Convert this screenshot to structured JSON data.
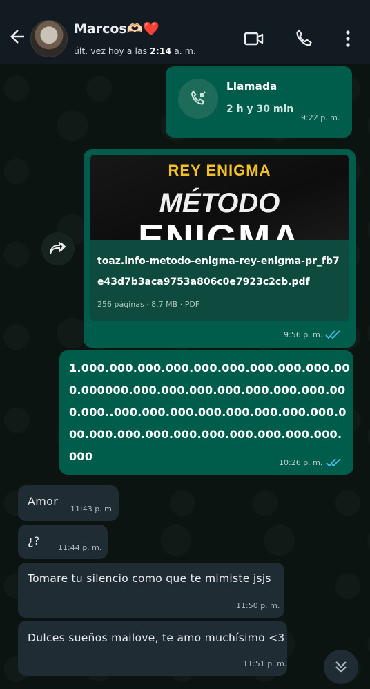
{
  "header": {
    "contact_name": "Marcos🫶🏻❤️",
    "status_prefix": "últ. vez hoy a las ",
    "status_time": "2:14",
    "status_suffix": " a. m."
  },
  "colors": {
    "outgoing_bubble": "#005c4b",
    "incoming_bubble": "#1f2c34",
    "read_ticks": "#53bdeb",
    "header_bg": "#121b22"
  },
  "messages": {
    "call": {
      "label": "Llamada",
      "duration": "2 h y 30 min",
      "time": "9:22 p. m."
    },
    "document": {
      "thumb_line1": "REY ENIGMA",
      "thumb_line2": "MÉTODO",
      "thumb_line3": "ENIGMA",
      "filename_line1": "toaz.info-metodo-enigma-rey-enigma-pr_fb7",
      "filename_line2": "e43d7b3aca9753a806c0e7923c2cb.pdf",
      "meta": "256 páginas · 8.7 MB · PDF",
      "time": "9:56 p. m."
    },
    "number": {
      "line1": "1.000.000.000.000.000.000.000.000.000.00",
      "line2": "0.000000.000.000.000.000.000.000.000.00",
      "line3": "0.000..000.000.000.000.000.000.000.000.0",
      "line4": "00.000.000.000.000.000.000.000.000.000.",
      "line5": "000",
      "time": "10:26 p. m."
    },
    "amor": {
      "text": "Amor",
      "time": "11:43 p. m."
    },
    "question": {
      "text": "¿?",
      "time": "11:44 p. m."
    },
    "silence": {
      "text": "Tomare tu silencio como que te mimiste jsjs",
      "time": "11:50 p. m."
    },
    "dreams": {
      "text": "Dulces sueños mailove, te amo muchísimo <3",
      "time": "11:51 p. m."
    }
  },
  "icons": [
    "back-arrow-icon",
    "video-call-icon",
    "phone-icon",
    "more-vert-icon",
    "incoming-call-icon",
    "forward-icon",
    "double-check-icon",
    "chevron-double-down-icon"
  ]
}
